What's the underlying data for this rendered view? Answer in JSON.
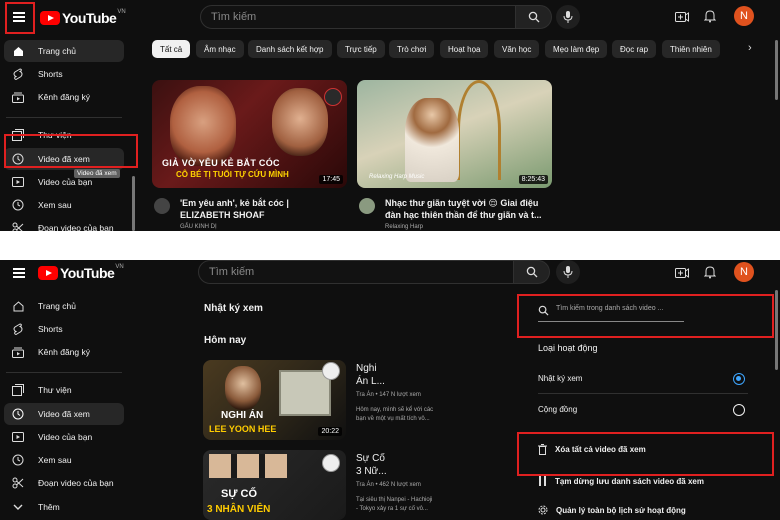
{
  "top": {
    "logo_text": "YouTube",
    "logo_region": "VN",
    "search_placeholder": "Tìm kiếm",
    "avatar_letter": "N",
    "sidebar": [
      {
        "label": "Trang chủ",
        "icon": "home-icon"
      },
      {
        "label": "Shorts",
        "icon": "shorts-icon"
      },
      {
        "label": "Kênh đăng ký",
        "icon": "subscriptions-icon"
      },
      {
        "label": "Thư viện",
        "icon": "library-icon"
      },
      {
        "label": "Video đã xem",
        "icon": "history-icon"
      },
      {
        "label": "Video của bạn",
        "icon": "your-videos-icon"
      },
      {
        "label": "Xem sau",
        "icon": "watch-later-icon"
      },
      {
        "label": "Đoạn video của bạn",
        "icon": "clips-icon"
      }
    ],
    "tooltip": "Video đã xem",
    "chips": [
      "Tất cả",
      "Âm nhạc",
      "Danh sách kết hợp",
      "Trực tiếp",
      "Trò chơi",
      "Hoạt họa",
      "Văn học",
      "Mẹo làm đẹp",
      "Đọc rap",
      "Thiên nhiên"
    ],
    "videos": [
      {
        "title_line1": "'Em yêu anh', kẻ bắt cóc |",
        "title_line2": "ELIZABETH SHOAF",
        "channel": "GẤU KINH DỊ",
        "duration": "17:45",
        "thumb_text1": "GIẢ VỜ YÊU KẺ BẮT CÓC",
        "thumb_text2": "CÔ BÉ TỊ TUỔI TỰ CỨU MÌNH"
      },
      {
        "title_line1": "Nhạc thư giãn tuyệt vời 😌 Giai điệu",
        "title_line2": "đàn hạc thiên thần để thư giãn và t...",
        "channel": "Relaxing Harp",
        "duration": "8:25:43",
        "thumb_text1": "Relaxing Harp Music"
      }
    ]
  },
  "bottom": {
    "logo_text": "YouTube",
    "logo_region": "VN",
    "search_placeholder": "Tìm kiếm",
    "avatar_letter": "N",
    "sidebar": [
      {
        "label": "Trang chủ",
        "icon": "home-icon"
      },
      {
        "label": "Shorts",
        "icon": "shorts-icon"
      },
      {
        "label": "Kênh đăng ký",
        "icon": "subscriptions-icon"
      },
      {
        "label": "Thư viện",
        "icon": "library-icon"
      },
      {
        "label": "Video đã xem",
        "icon": "history-icon"
      },
      {
        "label": "Video của bạn",
        "icon": "your-videos-icon"
      },
      {
        "label": "Xem sau",
        "icon": "watch-later-icon"
      },
      {
        "label": "Đoạn video của bạn",
        "icon": "clips-icon"
      },
      {
        "label": "Thêm",
        "icon": "chevron-down-icon"
      }
    ],
    "history_title": "Nhật ký xem",
    "today": "Hôm nay",
    "history": [
      {
        "title_line1": "Nghi",
        "title_line2": "Án L...",
        "meta": "Tra Án • 147 N lượt xem",
        "desc_line1": "Hôm nay, mình sẽ kể với các",
        "desc_line2": "bạn về một vụ mất tích vô...",
        "duration": "20:22",
        "thumb_text1": "NGHI ÁN",
        "thumb_text2": "LEE YOON HEE"
      },
      {
        "title_line1": "Sự Cố",
        "title_line2": "3 Nữ...",
        "meta": "Tra Án • 462 N lượt xem",
        "desc_line1": "Tại siêu thị Nanpei - Hachioji",
        "desc_line2": "- Tokyo xảy ra 1 sự cố vô...",
        "thumb_text1": "SỰ CỐ",
        "thumb_text2": "3 NHÂN VIÊN"
      }
    ],
    "right_panel": {
      "search_placeholder": "Tìm kiếm trong danh sách video ...",
      "activity_type": "Loại hoạt động",
      "options": [
        {
          "label": "Nhật ký xem",
          "selected": true
        },
        {
          "label": "Cộng đồng",
          "selected": false
        }
      ],
      "clear_all": "Xóa tất cả video đã xem",
      "pause": "Tạm dừng lưu danh sách video đã xem",
      "manage": "Quản lý toàn bộ lịch sử hoạt động"
    }
  },
  "colors": {
    "highlight": "#e02020",
    "brand": "#ff0000",
    "accent": "#3ea6ff",
    "avatar": "#e0521e"
  }
}
